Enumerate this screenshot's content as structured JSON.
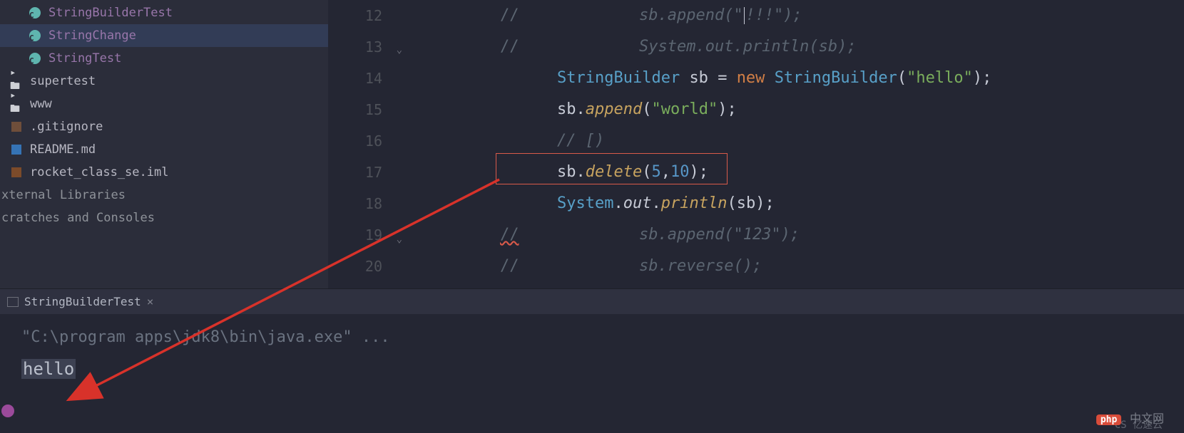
{
  "sidebar": {
    "items": [
      {
        "label": "StringBuilderTest",
        "icon": "class",
        "indent": 40
      },
      {
        "label": "StringChange",
        "icon": "class",
        "indent": 40,
        "selected": true
      },
      {
        "label": "StringTest",
        "icon": "class",
        "indent": 40
      },
      {
        "label": "supertest",
        "icon": "folder",
        "indent": 14
      },
      {
        "label": "www",
        "icon": "folder",
        "indent": 14
      },
      {
        "label": ".gitignore",
        "icon": "gitignore",
        "indent": 14
      },
      {
        "label": "README.md",
        "icon": "readme",
        "indent": 14
      },
      {
        "label": "rocket_class_se.iml",
        "icon": "iml",
        "indent": 14
      }
    ],
    "roots": [
      "xternal Libraries",
      "cratches and Consoles"
    ]
  },
  "editor": {
    "lines": [
      {
        "n": "12",
        "html": "<span class='ci'><span class='cs'>//</span></span><span class='comment'>sb.append(\"</span><span class='cursor-bar'></span><span class='comment'>!!!\");</span>"
      },
      {
        "n": "13",
        "html": "<span class='ci'><span class='cs'>//</span></span><span class='comment'>System.out.println(sb);</span>"
      },
      {
        "n": "14",
        "html": "<span class='type'>StringBuilder</span> <span class='ident'>sb</span> <span class='op'>=</span> <span class='kw'>new</span> <span class='type'>StringBuilder</span><span class='op'>(</span><span class='str'>\"hello\"</span><span class='op'>);</span>"
      },
      {
        "n": "15",
        "html": "<span class='ident'>sb</span><span class='dot'>.</span><span class='method'>append</span><span class='op'>(</span><span class='str'>\"world\"</span><span class='op'>);</span>"
      },
      {
        "n": "16",
        "html": "<span class='comment'>// [)</span>"
      },
      {
        "n": "17",
        "html": "<span class='ident'>sb</span><span class='dot'>.</span><span class='method'>delete</span><span class='op'>(</span><span class='num'>5</span><span class='op'>,</span><span class='num'>10</span><span class='op'>);</span>"
      },
      {
        "n": "18",
        "html": "<span class='type'>System</span><span class='dot'>.</span><span class='ident' style='font-style:italic'>out</span><span class='dot'>.</span><span class='method'>println</span><span class='op'>(</span><span class='ident'>sb</span><span class='op'>);</span>"
      },
      {
        "n": "19",
        "html": "<span class='ci'><span class='cs squiggle'>//</span></span><span class='comment'>sb.append(\"123\");</span>"
      },
      {
        "n": "20",
        "html": "<span class='ci'><span class='cs'>//</span></span><span class='comment'>sb.reverse();</span>"
      }
    ]
  },
  "run": {
    "tab": "StringBuilderTest",
    "cmd": "\"C:\\program apps\\jdk8\\bin\\java.exe\" ...",
    "output": "hello"
  },
  "watermark": {
    "brand": "php",
    "cn": "中文网",
    "sub": "CS   亿速云"
  }
}
